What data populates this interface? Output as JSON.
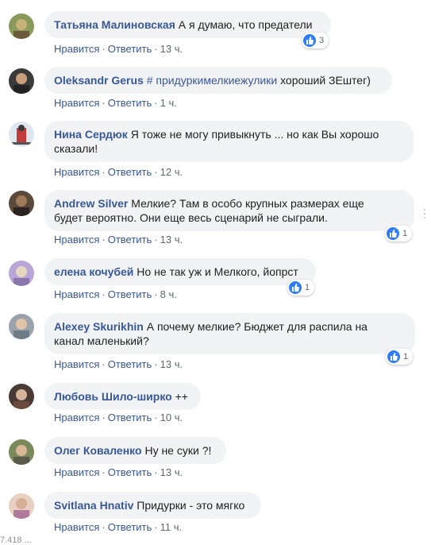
{
  "ui": {
    "like_label": "Нравится",
    "reply_label": "Ответить",
    "separator": "·",
    "like_icon": "thumbs-up-icon",
    "reaction_color": "#2e7cf6",
    "author_color": "#385898",
    "bubble_color": "#f2f3f5",
    "cut_text": "7.418 ..."
  },
  "comments": [
    {
      "author": "Татьяна Малиновская",
      "text": "А я думаю, что предатели",
      "time": "13 ч.",
      "reactions": "3",
      "avatar_colors": [
        "#8a9a5b",
        "#c9b27a"
      ]
    },
    {
      "author": "Oleksandr Gerus",
      "hashtag": "# придуркимелкиежулики",
      "text": "хороший ЗЕштег)",
      "time": "1 ч.",
      "avatar_colors": [
        "#3a3a3a",
        "#c8a17a"
      ]
    },
    {
      "author": "Нина Сердюк",
      "text": "Я тоже не могу привыкнуть ... но как Вы хорошо",
      "text2": "сказали!",
      "time": "12 ч.",
      "avatar_colors": [
        "#c23b3b",
        "#dfe6ef"
      ]
    },
    {
      "author": "Andrew Silver",
      "text": "Мелкие? Там в особо крупных размерах еще",
      "text2": "будет вероятно. Они еще весь сценарий не сыграли.",
      "time": "13 ч.",
      "reactions": "1",
      "avatar_colors": [
        "#5b4a3a",
        "#a07a5b"
      ]
    },
    {
      "author": "елена кочубей",
      "text": "Но не так уж и Мелкого, йопрст",
      "time": "8 ч.",
      "reactions": "1",
      "avatar_colors": [
        "#b8a6d6",
        "#e6d6c2"
      ]
    },
    {
      "author": "Alexey Skurikhin",
      "text": "А почему мелкие? Бюджет для распила на",
      "text2": "канал маленький?",
      "time": "13 ч.",
      "reactions": "1",
      "avatar_colors": [
        "#6f7b86",
        "#e2c4a8"
      ]
    },
    {
      "author": "Любовь Шило-ширко",
      "text": "++",
      "time": "10 ч.",
      "avatar_colors": [
        "#4a3a35",
        "#d6b39b"
      ]
    },
    {
      "author": "Олег Коваленко",
      "text": "Ну не суки ?!",
      "time": "13 ч.",
      "avatar_colors": [
        "#7a8a5a",
        "#d8b896"
      ]
    },
    {
      "author": "Svitlana Hnativ",
      "text": "Придурки - это мягко",
      "time": "11 ч.",
      "avatar_colors": [
        "#b07a9a",
        "#e8d0c2"
      ]
    }
  ]
}
